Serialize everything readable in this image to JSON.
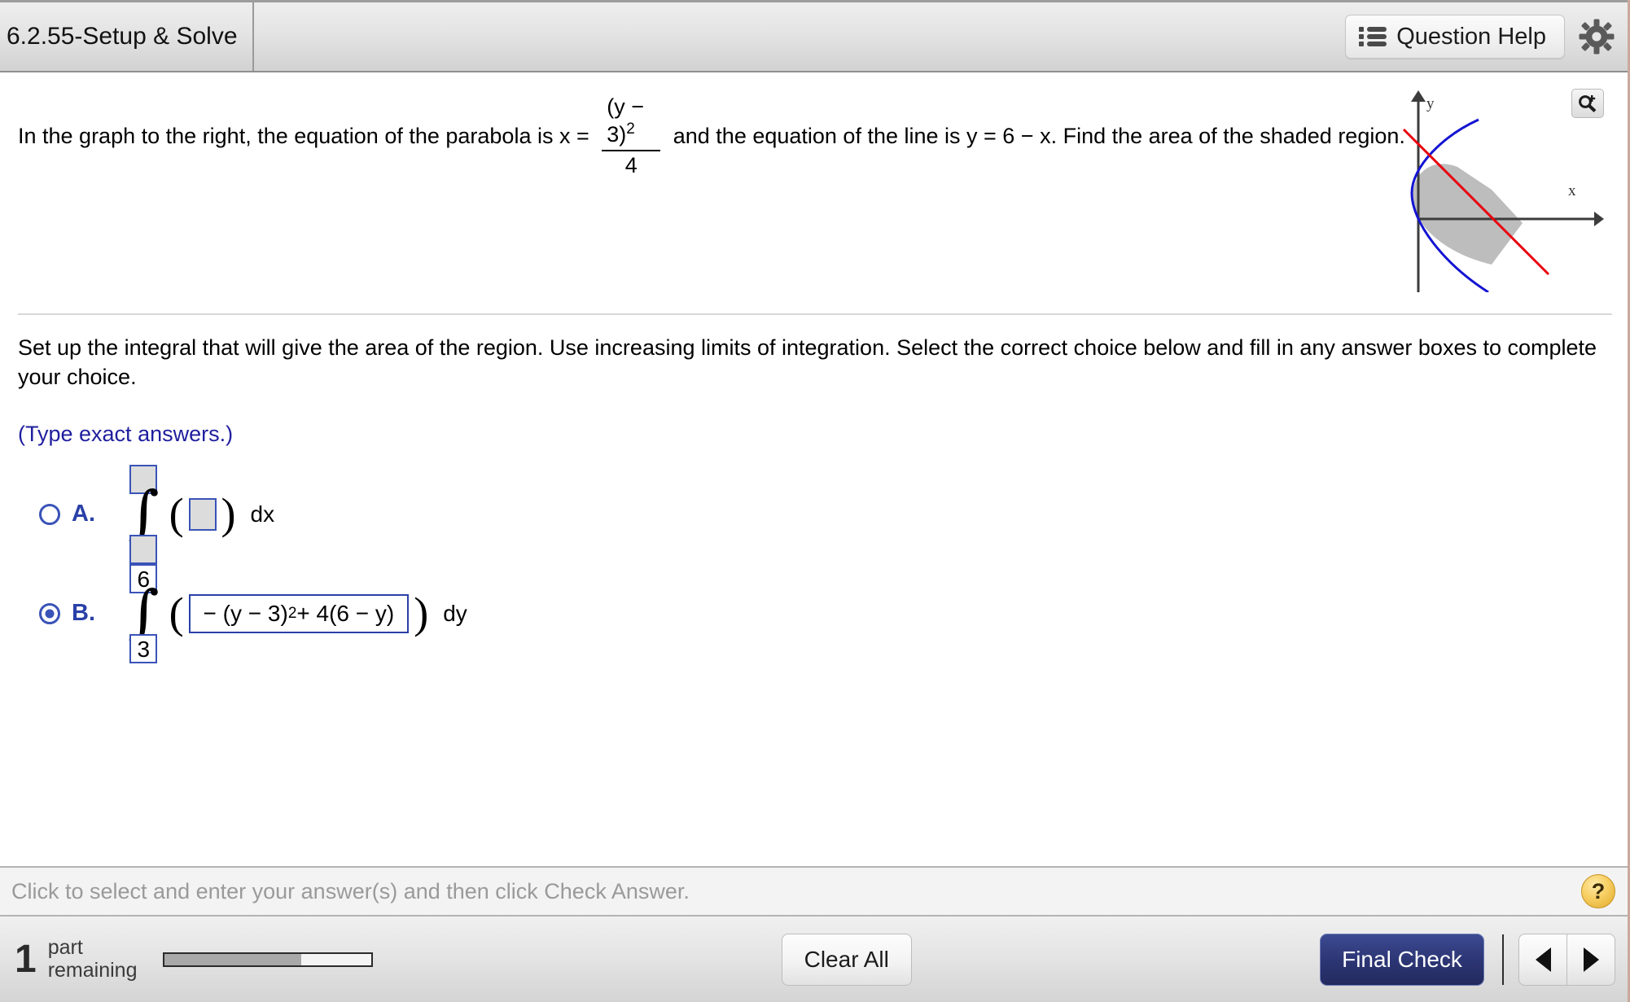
{
  "titlebar": {
    "tab_label": "6.2.55-Setup & Solve",
    "question_help_label": "Question Help",
    "help_icon": "list-icon",
    "settings_icon": "gear-icon"
  },
  "problem": {
    "text_before_fraction": "In the graph to the right, the equation of the parabola is x = ",
    "fraction": {
      "numerator_base": "(y − 3)",
      "numerator_exponent": "2",
      "denominator": "4"
    },
    "text_after_fraction": " and the equation of the line is y = 6 − x. Find the area of the shaded region.",
    "graph": {
      "zoom_icon": "magnifier-zoom-icon",
      "x_axis_label": "x",
      "y_axis_label": "y",
      "parabola_color": "#1414d2",
      "line_color": "#e8000c",
      "shade_color": "#bdbdbd",
      "axis_color": "#3c3c3c"
    }
  },
  "question": {
    "instruction": "Set up the integral that will give the area of the region. Use increasing limits of integration. Select the correct choice below and fill in any answer boxes to complete your choice.",
    "hint": "(Type exact answers.)",
    "choices": [
      {
        "letter": "A.",
        "selected": false,
        "upper_limit": "",
        "lower_limit": "",
        "integrand": "",
        "differential": "dx"
      },
      {
        "letter": "B.",
        "selected": true,
        "upper_limit": "6",
        "lower_limit": "3",
        "integrand_prefix": "− (y − 3)",
        "integrand_exponent": "2",
        "integrand_suffix": " + 4(6 − y)",
        "differential": "dy"
      }
    ]
  },
  "status": {
    "message": "Click to select and enter your answer(s) and then click Check Answer.",
    "help_badge": "?"
  },
  "bottombar": {
    "parts_count": "1",
    "parts_label_line1": "part",
    "parts_label_line2": "remaining",
    "progress_percent": 66,
    "clear_all_label": "Clear All",
    "final_check_label": "Final Check",
    "prev_icon": "triangle-left-icon",
    "next_icon": "triangle-right-icon"
  }
}
